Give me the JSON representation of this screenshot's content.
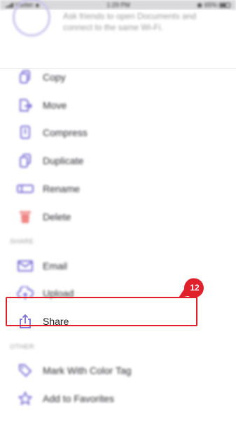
{
  "status_bar": {
    "carrier": "Viettel",
    "time": "1:29 PM",
    "battery": "65%"
  },
  "header": {
    "info_text": "Ask friends to open Documents and connect to the same Wi-Fi."
  },
  "actions": [
    {
      "label": "Copy",
      "icon": "copy-icon"
    },
    {
      "label": "Move",
      "icon": "move-icon"
    },
    {
      "label": "Compress",
      "icon": "compress-icon"
    },
    {
      "label": "Duplicate",
      "icon": "duplicate-icon"
    },
    {
      "label": "Rename",
      "icon": "rename-icon"
    },
    {
      "label": "Delete",
      "icon": "trash-icon"
    }
  ],
  "share_section": {
    "title": "SHARE",
    "items": [
      {
        "label": "Email",
        "icon": "mail-icon"
      },
      {
        "label": "Upload",
        "icon": "cloud-upload-icon"
      },
      {
        "label": "Share",
        "icon": "share-icon"
      }
    ]
  },
  "other_section": {
    "title": "OTHER",
    "items": [
      {
        "label": "Mark With Color Tag",
        "icon": "tag-icon"
      },
      {
        "label": "Add to Favorites",
        "icon": "star-icon"
      }
    ]
  },
  "annotation": {
    "step_number": "12"
  },
  "colors": {
    "accent": "#7b6fd6",
    "delete": "#f08585",
    "highlight": "#e0202a"
  }
}
